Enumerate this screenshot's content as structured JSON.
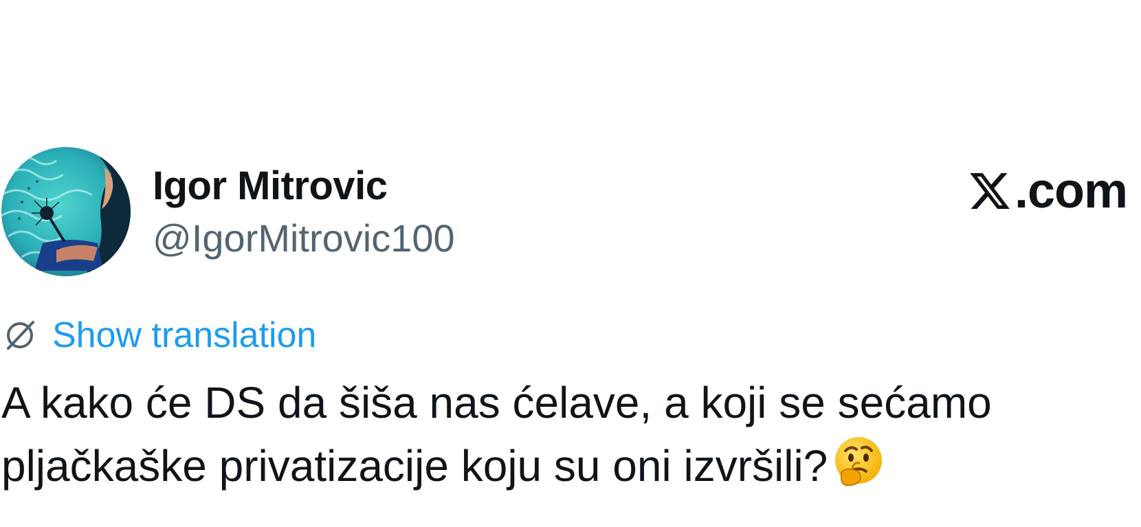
{
  "tweet": {
    "author": {
      "display_name": "Igor Mitrovic",
      "handle": "@IgorMitrovic100",
      "avatar_icon": "avatar-dandelion-painting"
    },
    "brand": {
      "logo_icon": "x-logo-icon",
      "text": ".com"
    },
    "translation": {
      "icon": "translate-globe-icon",
      "label": "Show translation"
    },
    "text_lines": [
      "A kako će DS da šiša nas ćelave, a koji se sećamo",
      "pljačkaške privatizacije koju su oni izvršili?"
    ],
    "emoji": "thinking-face",
    "colors": {
      "text": "#0f1419",
      "handle": "#536471",
      "link": "#1d9bf0",
      "background": "#ffffff"
    }
  }
}
